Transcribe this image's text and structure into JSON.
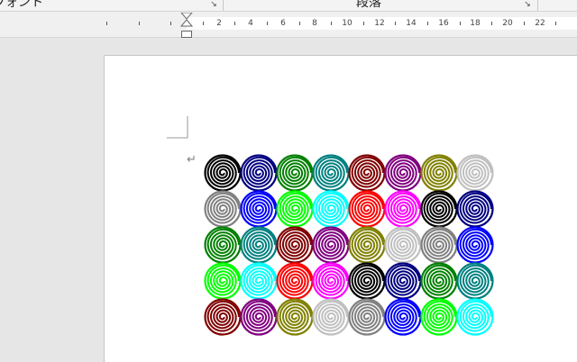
{
  "ribbon": {
    "font_group_label": "フォント",
    "paragraph_group_label": "段落"
  },
  "ruler": {
    "numbers": [
      "2",
      "4",
      "6",
      "8",
      "10",
      "12",
      "14",
      "16",
      "18",
      "20",
      "22"
    ]
  },
  "document": {
    "paragraph_mark": "↵",
    "spiral_rows": [
      [
        "black",
        "navy",
        "green",
        "teal",
        "maroon",
        "purple",
        "olive",
        "silver"
      ],
      [
        "gray",
        "blue",
        "lime",
        "aqua",
        "red",
        "fuchsia",
        "black",
        "navy"
      ],
      [
        "green",
        "teal",
        "maroon",
        "purple",
        "olive",
        "silver",
        "gray",
        "blue"
      ],
      [
        "lime",
        "aqua",
        "red",
        "fuchsia",
        "black",
        "navy",
        "green",
        "teal"
      ],
      [
        "maroon",
        "purple",
        "olive",
        "silver",
        "gray",
        "blue",
        "lime",
        "aqua"
      ]
    ]
  },
  "colors": {
    "black": "#000000",
    "navy": "#000080",
    "green": "#008000",
    "teal": "#008080",
    "maroon": "#800000",
    "purple": "#800080",
    "olive": "#808000",
    "silver": "#c0c0c0",
    "gray": "#808080",
    "blue": "#0000ff",
    "lime": "#00ff00",
    "aqua": "#00ffff",
    "red": "#ff0000",
    "fuchsia": "#ff00ff"
  }
}
